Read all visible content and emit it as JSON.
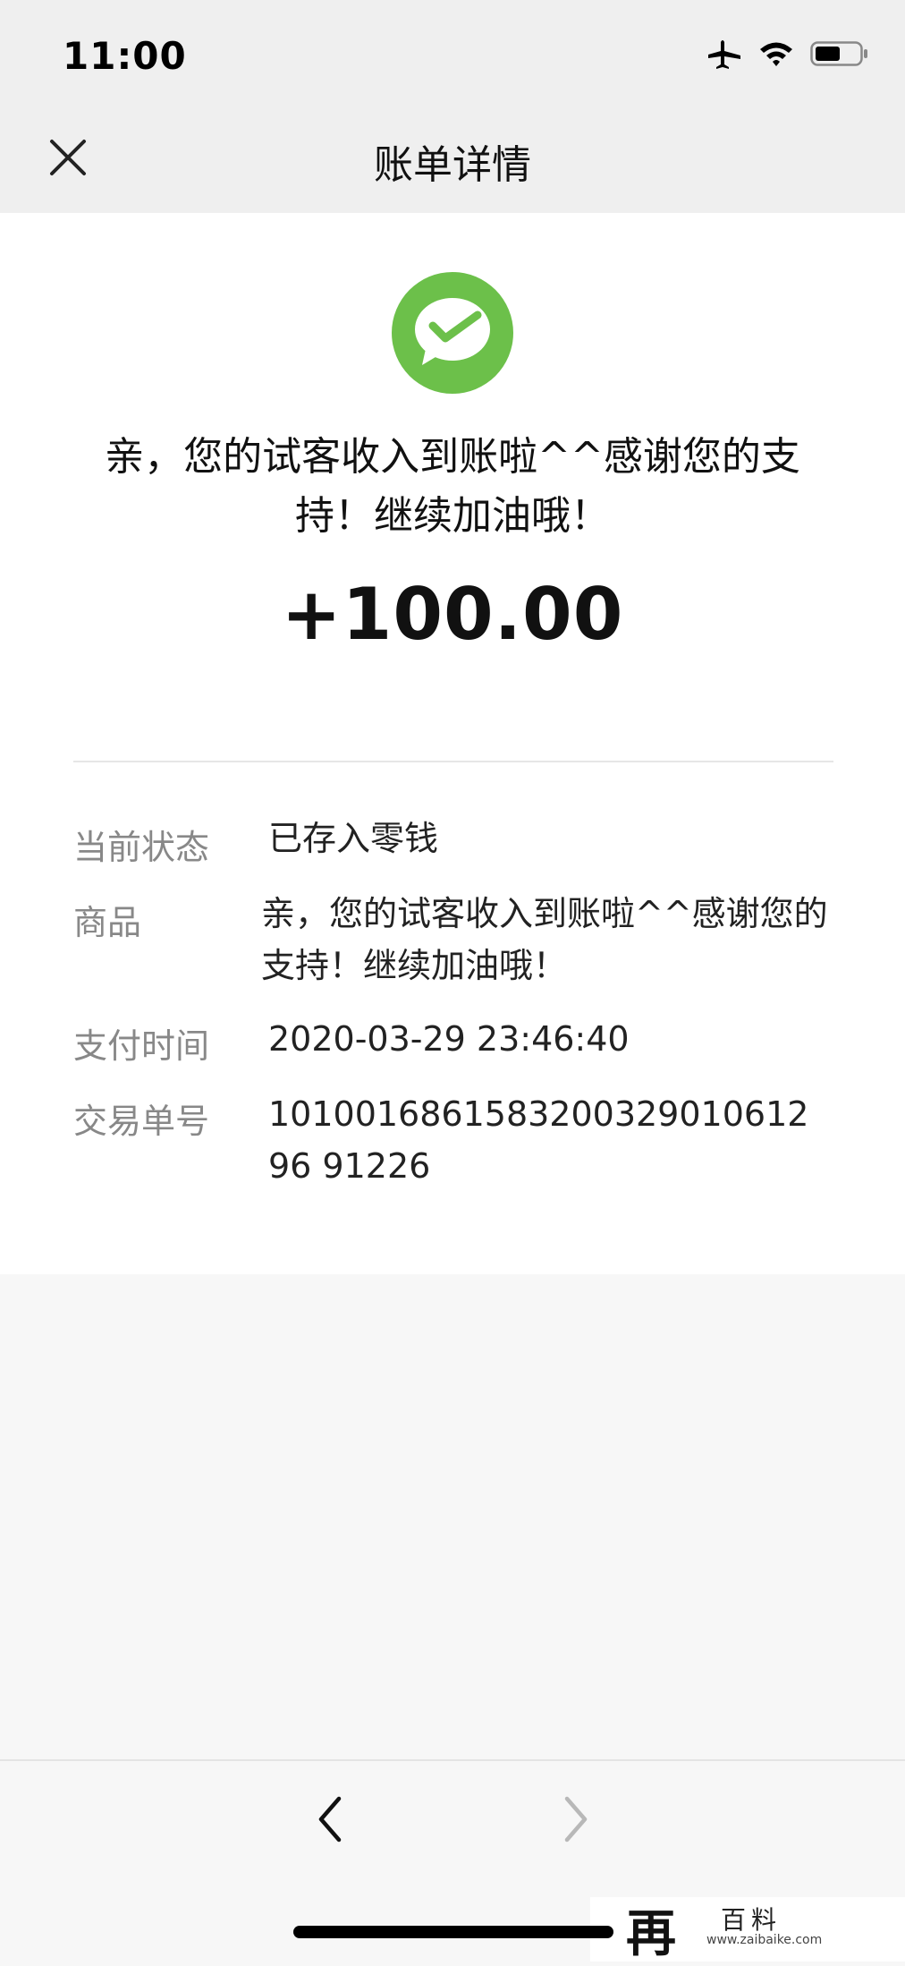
{
  "status_bar": {
    "time": "11:00",
    "icons": [
      "airplane-icon",
      "wifi-icon",
      "battery-icon"
    ]
  },
  "nav": {
    "title": "账单详情",
    "close_icon": "close-icon"
  },
  "receipt": {
    "logo_icon": "wechat-pay-icon",
    "logo_color": "#6cc04a",
    "headline": "亲，您的试客收入到账啦^^感谢您的支持！继续加油哦！",
    "amount": "+100.00"
  },
  "details": [
    {
      "label": "当前状态",
      "value": "已存入零钱"
    },
    {
      "label": "商品",
      "value": "亲，您的试客收入到账啦^^感谢您的支持！继续加油哦！"
    },
    {
      "label": "支付时间",
      "value": "2020-03-29 23:46:40"
    },
    {
      "label": "交易单号",
      "value": "101001686158320032901061296 91226"
    }
  ],
  "bottom_nav": {
    "back_icon": "chevron-left-icon",
    "forward_icon": "chevron-right-icon"
  },
  "watermark": {
    "glyph": "再",
    "text": "百料",
    "url": "www.zaibaike.com"
  }
}
